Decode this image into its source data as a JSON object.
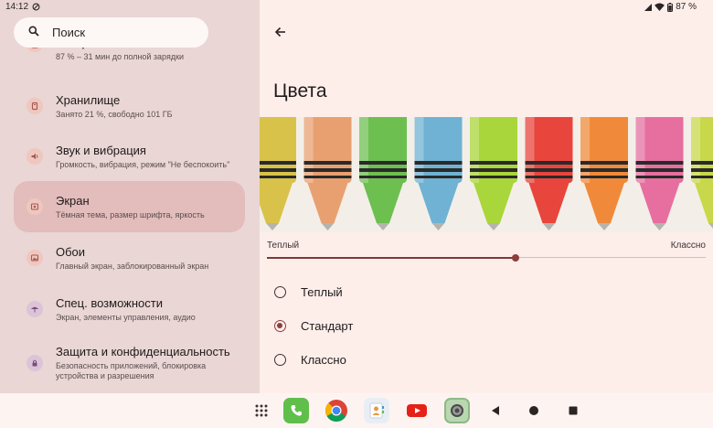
{
  "status": {
    "time": "14:12",
    "battery": "87 %"
  },
  "search": {
    "placeholder": "Поиск"
  },
  "settings": [
    {
      "title": "Батарея",
      "subtitle": "87 % – 31 мин до полной зарядки",
      "icon": "battery-icon",
      "active": false
    },
    {
      "title": "Хранилище",
      "subtitle": "Занято 21 %, свободно 101 ГБ",
      "icon": "storage-icon",
      "active": false
    },
    {
      "title": "Звук и вибрация",
      "subtitle": "Громкость, вибрация, режим \"Не беспокоить\"",
      "icon": "volume-icon",
      "active": false
    },
    {
      "title": "Экран",
      "subtitle": "Тёмная тема, размер шрифта, яркость",
      "icon": "display-icon",
      "active": true
    },
    {
      "title": "Обои",
      "subtitle": "Главный экран, заблокированный экран",
      "icon": "wallpaper-icon",
      "active": false
    },
    {
      "title": "Спец. возможности",
      "subtitle": "Экран, элементы управления, аудио",
      "icon": "accessibility-icon",
      "active": false
    },
    {
      "title": "Защита и конфиденциальность",
      "subtitle": "Безопасность приложений, блокировка устройства и разрешения",
      "icon": "lock-icon",
      "active": false
    }
  ],
  "detail": {
    "title": "Цвета",
    "slider": {
      "min_label": "Теплый",
      "max_label": "Классно",
      "value": 0.5
    },
    "options": [
      {
        "label": "Теплый",
        "selected": false
      },
      {
        "label": "Стандарт",
        "selected": true
      },
      {
        "label": "Классно",
        "selected": false
      }
    ]
  },
  "colors": {
    "accent": "#8c3f3f",
    "active_item": "#e3bcbc",
    "left_bg": "#e9d6d5",
    "right_bg": "#fdeeea"
  },
  "banner_crayons": [
    "#d9c24a",
    "#e9a070",
    "#6dbf50",
    "#6fb2d3",
    "#a9d63a",
    "#e8453d",
    "#f08a3a",
    "#e66fa0",
    "#c8d84a"
  ],
  "taskbar": {
    "apps": [
      "app-drawer-icon",
      "phone-app-icon",
      "chrome-app-icon",
      "contacts-app-icon",
      "youtube-app-icon",
      "settings-app-icon"
    ],
    "nav": [
      "back-icon",
      "home-icon",
      "recents-icon"
    ]
  }
}
